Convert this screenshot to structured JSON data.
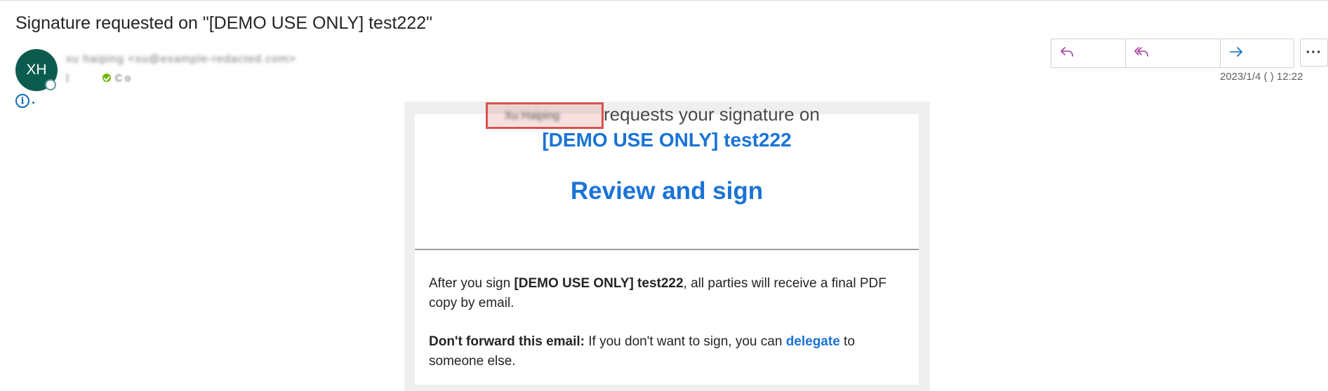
{
  "email": {
    "subject": "Signature requested on \"[DEMO USE ONLY] test222\"",
    "sender_initials": "XH",
    "sender_name_redacted": "xu haiping <xu@example-redacted.com>",
    "recipient_redacted": "C   o",
    "timestamp": "2023/1/4 (  ) 12:22"
  },
  "toolbar": {
    "reply_icon": "reply-icon",
    "reply_all_icon": "reply-all-icon",
    "forward_icon": "forward-icon",
    "more_label": "···"
  },
  "message": {
    "sender_redacted": "Xu Haiping",
    "requests_text": "requests your signature on",
    "document_title": "[DEMO USE ONLY] test222",
    "review_label": "Review and sign",
    "para1_before": "After you sign ",
    "para1_bold": "[DEMO USE ONLY] test222",
    "para1_after": ", all parties will receive a final PDF copy by email.",
    "para2_bold": "Don't forward this email:",
    "para2_before_link": " If you don't want to sign, you can ",
    "para2_link": "delegate",
    "para2_after": " to someone else."
  },
  "colors": {
    "avatar_bg": "#0b5c4f",
    "link_blue": "#1a73d6",
    "redact_red": "#d9534f",
    "reply_purple": "#a33d9e",
    "forward_blue": "#0f6cbd"
  }
}
